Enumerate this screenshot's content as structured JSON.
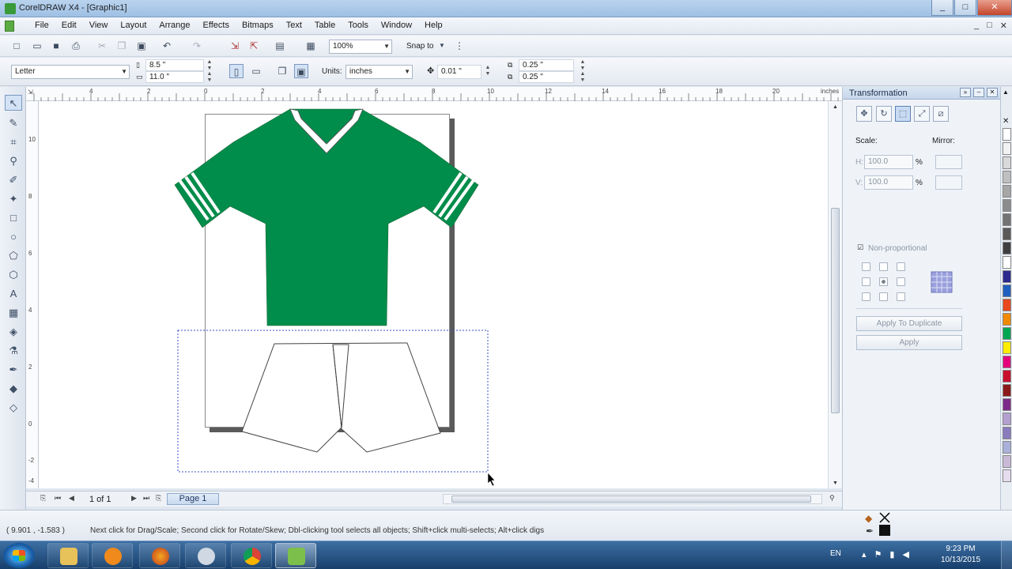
{
  "window": {
    "title": "CorelDRAW X4 - [Graphic1]",
    "controls": [
      "_",
      "□",
      "✕"
    ]
  },
  "menu": {
    "items": [
      "File",
      "Edit",
      "View",
      "Layout",
      "Arrange",
      "Effects",
      "Bitmaps",
      "Text",
      "Table",
      "Tools",
      "Window",
      "Help"
    ],
    "mdi_controls": [
      "_",
      "□",
      "✕"
    ]
  },
  "standard_toolbar": {
    "zoom": "100%",
    "snap_to": "Snap to"
  },
  "property_bar": {
    "paper_size": "Letter",
    "width": "8.5 \"",
    "height": "11.0 \"",
    "units_label": "Units:",
    "units_value": "inches",
    "nudge": "0.01 \"",
    "dup_x": "0.25 \"",
    "dup_y": "0.25 \""
  },
  "ruler": {
    "h_labels": [
      "4",
      "2",
      "0",
      "2",
      "4",
      "6",
      "8",
      "10",
      "12",
      "14",
      "16",
      "18",
      "20",
      "inches"
    ],
    "v_labels": [
      "10",
      "8",
      "6",
      "4",
      "2",
      "0",
      "-2",
      "-4"
    ]
  },
  "navigator": {
    "page_count": "1 of 1",
    "page_tab": "Page 1"
  },
  "docker": {
    "title": "Transformation",
    "scale_label": "Scale:",
    "mirror_label": "Mirror:",
    "h_label": "H:",
    "v_label": "V:",
    "h_value": "100.0",
    "v_value": "100.0",
    "percent": "%",
    "non_proportional": "Non-proportional",
    "apply_to_duplicate": "Apply To Duplicate",
    "apply": "Apply"
  },
  "palette": {
    "colors": [
      "#ffffff",
      "#f2f2f2",
      "#d9d9d9",
      "#bfbfbf",
      "#a6a6a6",
      "#8c8c8c",
      "#737373",
      "#595959",
      "#404040",
      "#ffffff",
      "#2c2a8f",
      "#1f5fbf",
      "#e8481e",
      "#f18a00",
      "#00a651",
      "#ffed00",
      "#e4007c",
      "#c8102e",
      "#8b1a1a",
      "#7d2a8a",
      "#b4a0d0",
      "#8a7bbf",
      "#a9b0d9",
      "#c9b9d6",
      "#e6dcef"
    ]
  },
  "status": {
    "coords": "( 9.901 , -1.583 )",
    "hint": "Next click for Drag/Scale; Second click for Rotate/Skew; Dbl-clicking tool selects all objects; Shift+click multi-selects; Alt+click digs"
  },
  "taskbar": {
    "language": "EN",
    "time": "9:23 PM",
    "date": "10/13/2015"
  },
  "colors": {
    "shirt": "#008c4a",
    "selection": "#3a4fc4"
  }
}
